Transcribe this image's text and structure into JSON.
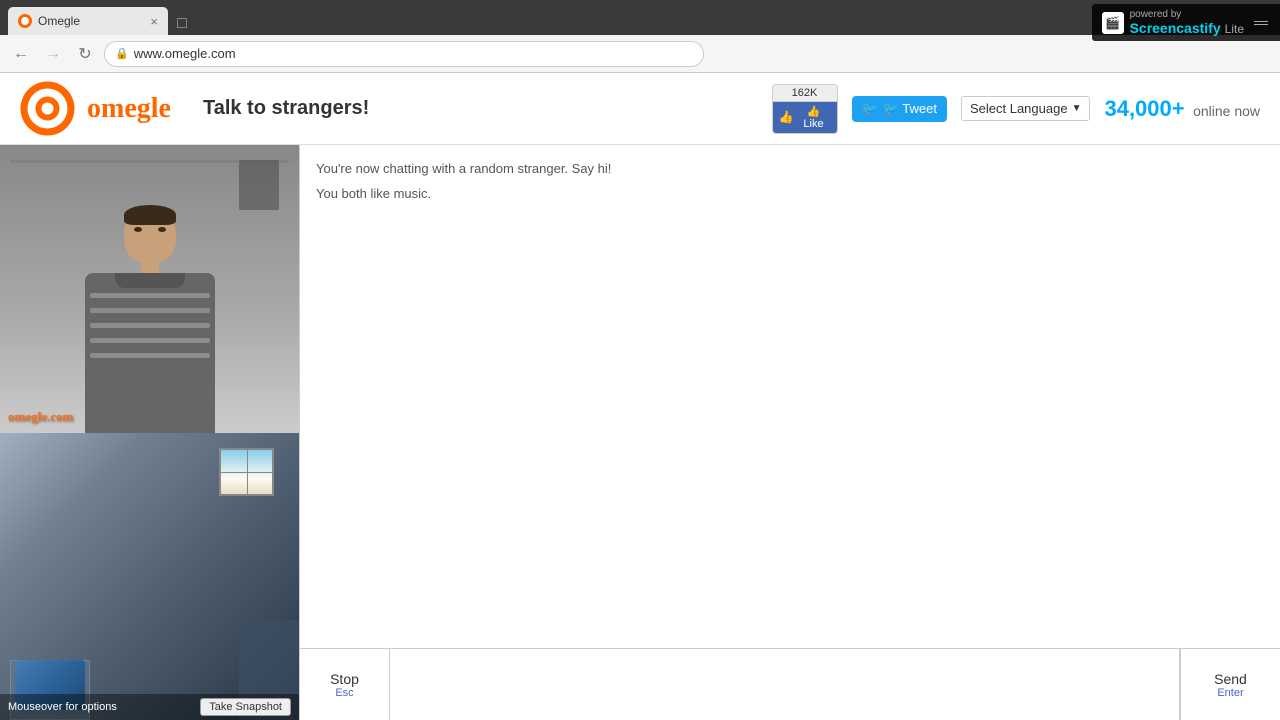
{
  "browser": {
    "url": "www.omegle.com",
    "tab_title": "Omegle",
    "tab_close": "×",
    "back_icon": "←",
    "forward_icon": "→",
    "refresh_icon": "↻"
  },
  "screencastify": {
    "powered_by": "powered by",
    "title": "Screencastify",
    "subtitle": "Lite"
  },
  "header": {
    "tagline": "Talk to strangers!",
    "like_count": "162K",
    "like_label": "👍 Like",
    "tweet_label": "🐦 Tweet",
    "select_language": "Select Language",
    "online_count": "34,000+",
    "online_label": "online now"
  },
  "chat": {
    "system_message1": "You're now chatting with a random stranger. Say hi!",
    "system_message2": "You both like music.",
    "stop_label": "Stop",
    "stop_shortcut": "Esc",
    "send_label": "Send",
    "send_shortcut": "Enter",
    "input_placeholder": ""
  },
  "video": {
    "watermark": "omegle.com",
    "mouseover_text": "Mouseover for options",
    "snapshot_label": "Take Snapshot"
  }
}
